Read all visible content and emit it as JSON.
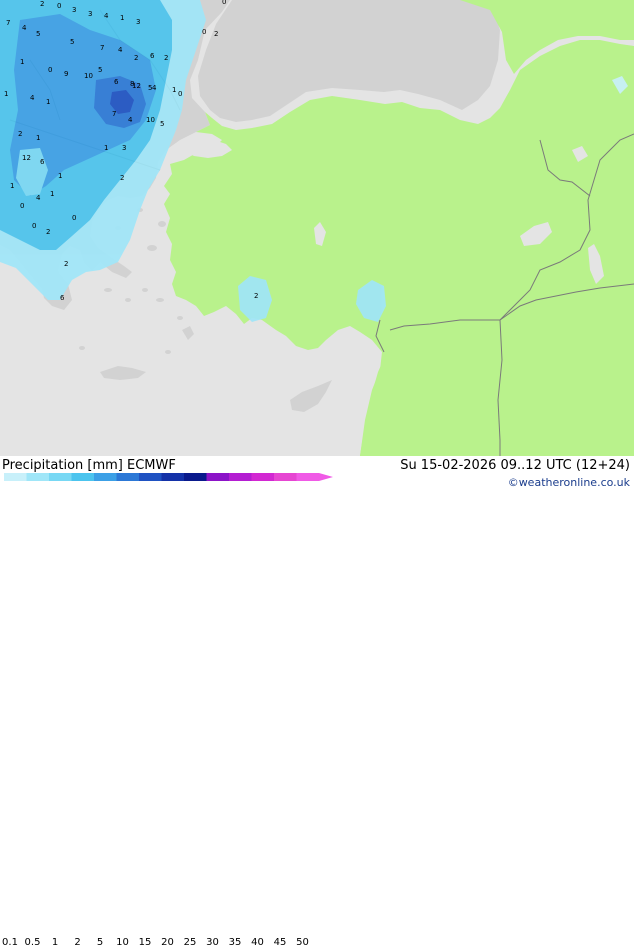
{
  "header": {
    "title": "Precipitation [mm]",
    "model": "ECMWF",
    "valid_time": "Su 15-02-2026 09..12 UTC (12+24)",
    "credit": "©weatheronline.co.uk"
  },
  "legend": {
    "labels": [
      "0.1",
      "0.5",
      "1",
      "2",
      "5",
      "10",
      "15",
      "20",
      "25",
      "30",
      "35",
      "40",
      "45",
      "50"
    ],
    "colors": [
      "#c8f0fa",
      "#a0e6f8",
      "#78d8f4",
      "#4cc4ee",
      "#3ca0e6",
      "#2c78d6",
      "#1f52c2",
      "#1432a8",
      "#0a1a8c",
      "#8c14c8",
      "#b41ed2",
      "#d228d2",
      "#e646d2",
      "#f05ae6"
    ]
  },
  "map": {
    "colors": {
      "sea": "#e4e4e4",
      "land": "#b9f28c",
      "outside_land": "#d2d2d2",
      "border": "#7a7a7a"
    },
    "values": [
      {
        "t": "2"
      },
      {
        "t": "0"
      },
      {
        "t": "3"
      },
      {
        "t": "3"
      },
      {
        "t": "4"
      },
      {
        "t": "1"
      },
      {
        "t": "3"
      },
      {
        "t": "7"
      },
      {
        "t": "4"
      },
      {
        "t": "5"
      },
      {
        "t": "5"
      },
      {
        "t": "7"
      },
      {
        "t": "4"
      },
      {
        "t": "2"
      },
      {
        "t": "6"
      },
      {
        "t": "2"
      },
      {
        "t": "1"
      },
      {
        "t": "0"
      },
      {
        "t": "9"
      },
      {
        "t": "10"
      },
      {
        "t": "5"
      },
      {
        "t": "6"
      },
      {
        "t": "8"
      },
      {
        "t": "4"
      },
      {
        "t": "1"
      },
      {
        "t": "12"
      },
      {
        "t": "5"
      },
      {
        "t": "1"
      },
      {
        "t": "4"
      },
      {
        "t": "1"
      },
      {
        "t": "7"
      },
      {
        "t": "4"
      },
      {
        "t": "10"
      },
      {
        "t": "5"
      },
      {
        "t": "2"
      },
      {
        "t": "1"
      },
      {
        "t": "12"
      },
      {
        "t": "6"
      },
      {
        "t": "1"
      },
      {
        "t": "3"
      },
      {
        "t": "1"
      },
      {
        "t": "4"
      },
      {
        "t": "1"
      },
      {
        "t": "0"
      },
      {
        "t": "2"
      },
      {
        "t": "2"
      },
      {
        "t": "1"
      },
      {
        "t": "0"
      },
      {
        "t": "6"
      },
      {
        "t": "2"
      },
      {
        "t": "0"
      },
      {
        "t": "0"
      },
      {
        "t": "2"
      },
      {
        "t": "0"
      },
      {
        "t": "2"
      },
      {
        "t": "0"
      }
    ]
  }
}
